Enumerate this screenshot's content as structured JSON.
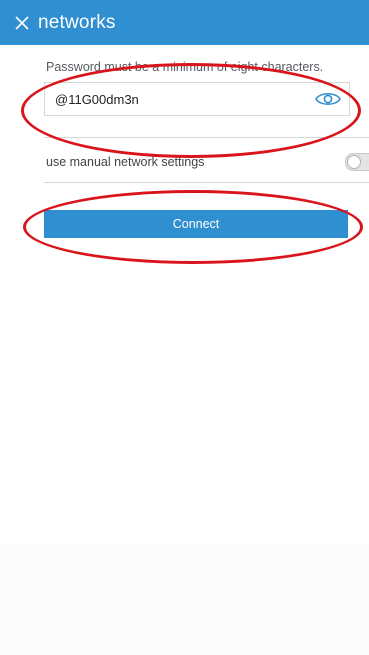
{
  "header": {
    "title": "networks",
    "close_icon": "close-icon"
  },
  "form": {
    "hint": "Password must be a minimum of eight characters.",
    "password_value": "@11G00dm3n",
    "reveal_icon": "eye-icon",
    "manual_label": "use manual network settings",
    "manual_toggle_on": false,
    "connect_label": "Connect"
  },
  "colors": {
    "accent": "#2f8fd0",
    "annotation": "#d9141b"
  }
}
